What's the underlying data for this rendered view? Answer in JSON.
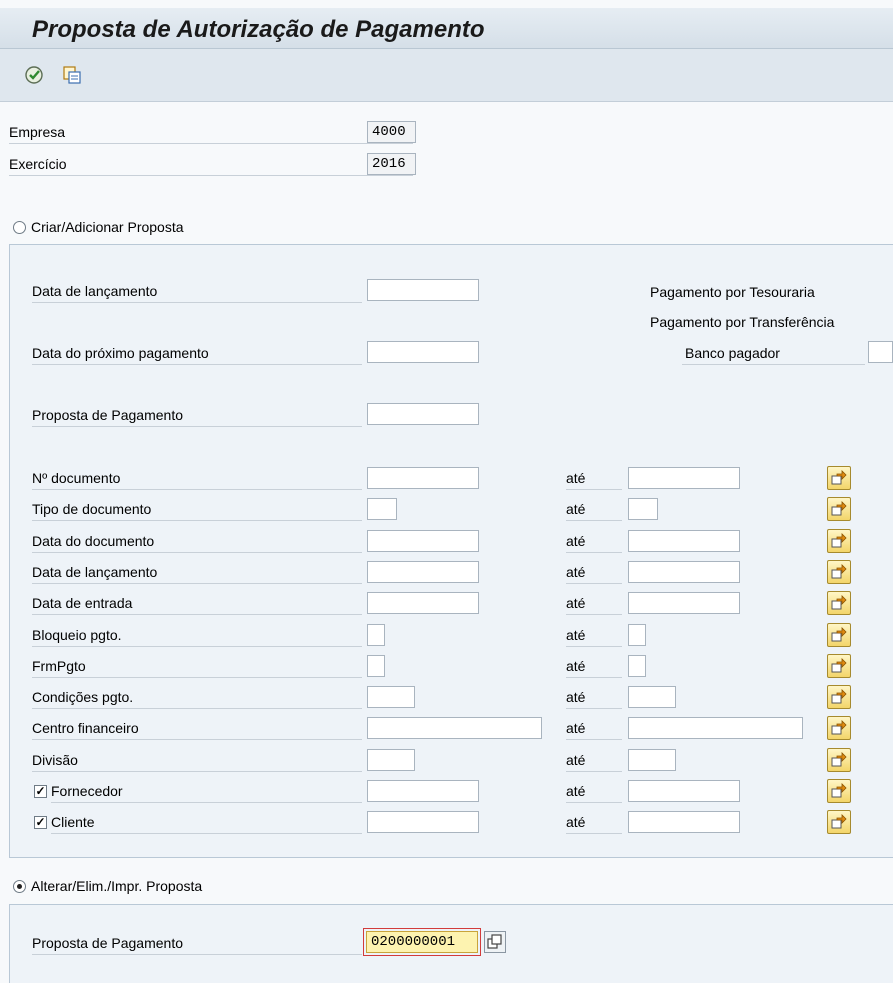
{
  "header": {
    "title": "Proposta de Autorização de Pagamento"
  },
  "toolbar": {
    "icons": [
      "execute-icon",
      "copy-icon"
    ]
  },
  "company": {
    "label": "Empresa",
    "value": "4000"
  },
  "fiscal_year": {
    "label": "Exercício",
    "value": "2016"
  },
  "create": {
    "radio_label": "Criar/Adicionar Proposta",
    "posting_date_label": "Data de lançamento",
    "next_payment_label": "Data do próximo pagamento",
    "payment_proposal_label": "Proposta de Pagamento",
    "treasury_label": "Pagamento por Tesouraria",
    "transfer_label": "Pagamento por Transferência",
    "paying_bank_label": "Banco pagador"
  },
  "ranges": {
    "to_label": "até",
    "rows": [
      {
        "label": "Nº documento"
      },
      {
        "label": "Tipo de documento"
      },
      {
        "label": "Data do documento"
      },
      {
        "label": "Data de lançamento"
      },
      {
        "label": "Data de entrada"
      },
      {
        "label": "Bloqueio pgto."
      },
      {
        "label": "FrmPgto"
      },
      {
        "label": "Condições pgto."
      },
      {
        "label": "Centro financeiro"
      },
      {
        "label": "Divisão"
      },
      {
        "label": "Fornecedor",
        "checked": true
      },
      {
        "label": "Cliente",
        "checked": true
      }
    ]
  },
  "change": {
    "radio_label": "Alterar/Elim./Impr. Proposta",
    "proposal_label": "Proposta de Pagamento",
    "proposal_value": "0200000001"
  },
  "colors": {
    "accent_yellow": "#f3d56a",
    "focus_field": "#fdf3b0",
    "highlight_red": "#d23b3b"
  }
}
